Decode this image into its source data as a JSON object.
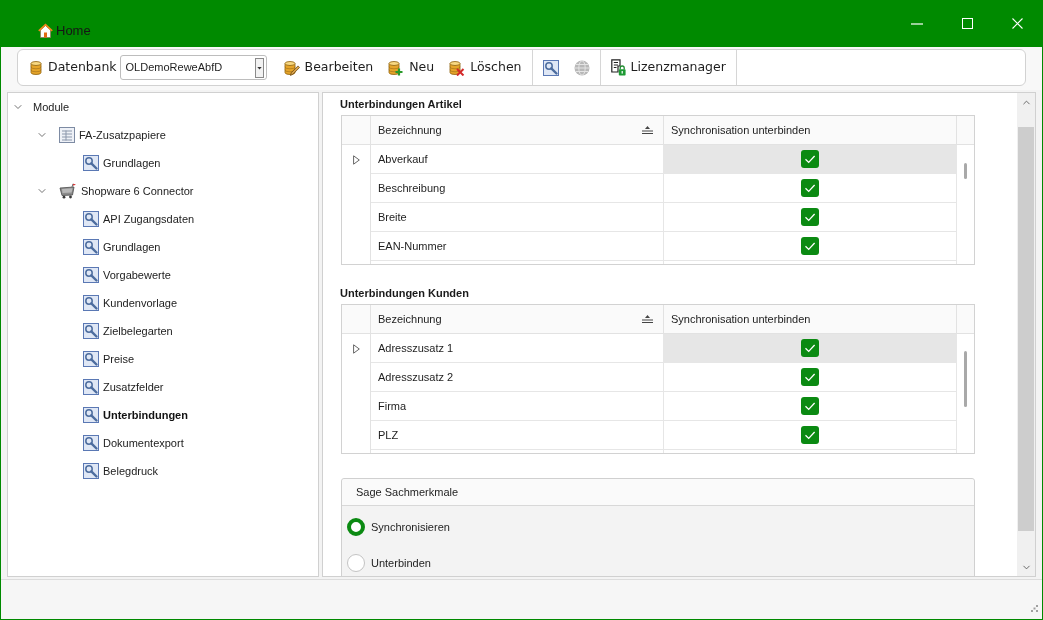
{
  "window": {
    "title": "Home"
  },
  "toolbar": {
    "database_label": "Datenbank",
    "database_select": {
      "value": "OLDemoReweAbfD"
    },
    "button_groups": [
      {
        "buttons": [
          {
            "kind": "edit",
            "label": "Bearbeiten",
            "disabled": false
          },
          {
            "kind": "new",
            "label": "Neu",
            "disabled": false
          },
          {
            "kind": "delete",
            "label": "Löschen",
            "disabled": false
          }
        ]
      },
      {
        "buttons": [
          {
            "kind": "settings",
            "disabled": false
          },
          {
            "kind": "globe",
            "disabled": true
          }
        ]
      },
      {
        "buttons": [
          {
            "kind": "license",
            "label": "Lizenzmanager",
            "disabled": false
          }
        ]
      }
    ]
  },
  "tree": [
    {
      "label": "Module",
      "expanded": true,
      "selected": false,
      "children": [
        {
          "label": "FA-Zusatzpapiere",
          "kind": "form",
          "expanded": true,
          "selected": false,
          "children": [
            {
              "label": "Grundlagen",
              "kind": "settings",
              "selected": false
            }
          ]
        },
        {
          "label": "Shopware 6 Connector",
          "kind": "connector",
          "expanded": true,
          "selected": false,
          "children": [
            {
              "label": "API Zugangsdaten",
              "kind": "settings",
              "selected": false
            },
            {
              "label": "Grundlagen",
              "kind": "settings",
              "selected": false
            },
            {
              "label": "Vorgabewerte",
              "kind": "settings",
              "selected": false
            },
            {
              "label": "Kundenvorlage",
              "kind": "settings",
              "selected": false
            },
            {
              "label": "Zielbelegarten",
              "kind": "settings",
              "selected": false
            },
            {
              "label": "Preise",
              "kind": "settings",
              "selected": false
            },
            {
              "label": "Zusatzfelder",
              "kind": "settings",
              "selected": false
            },
            {
              "label": "Unterbindungen",
              "kind": "settings",
              "selected": true
            },
            {
              "label": "Dokumentexport",
              "kind": "settings",
              "selected": false
            },
            {
              "label": "Belegdruck",
              "kind": "settings",
              "selected": false
            }
          ]
        }
      ]
    }
  ],
  "grids": [
    {
      "title": "Unterbindungen Artikel",
      "columns": [
        {
          "label": "Bezeichnung",
          "sorted": true
        },
        {
          "label": "Synchronisation unterbinden",
          "sorted": false
        }
      ],
      "rows": [
        {
          "name": "Abverkauf",
          "checked": true,
          "selected": true
        },
        {
          "name": "Beschreibung",
          "checked": true,
          "selected": false
        },
        {
          "name": "Breite",
          "checked": true,
          "selected": false
        },
        {
          "name": "EAN-Nummer",
          "checked": true,
          "selected": false
        }
      ]
    },
    {
      "title": "Unterbindungen Kunden",
      "columns": [
        {
          "label": "Bezeichnung",
          "sorted": true
        },
        {
          "label": "Synchronisation unterbinden",
          "sorted": false
        }
      ],
      "rows": [
        {
          "name": "Adresszusatz 1",
          "checked": true,
          "selected": true
        },
        {
          "name": "Adresszusatz 2",
          "checked": true,
          "selected": false
        },
        {
          "name": "Firma",
          "checked": true,
          "selected": false
        },
        {
          "name": "PLZ",
          "checked": true,
          "selected": false
        }
      ]
    }
  ],
  "option_group": {
    "title": "Sage Sachmerkmale",
    "options": [
      {
        "label": "Synchronisieren",
        "selected": true
      },
      {
        "label": "Unterbinden",
        "selected": false
      }
    ]
  }
}
